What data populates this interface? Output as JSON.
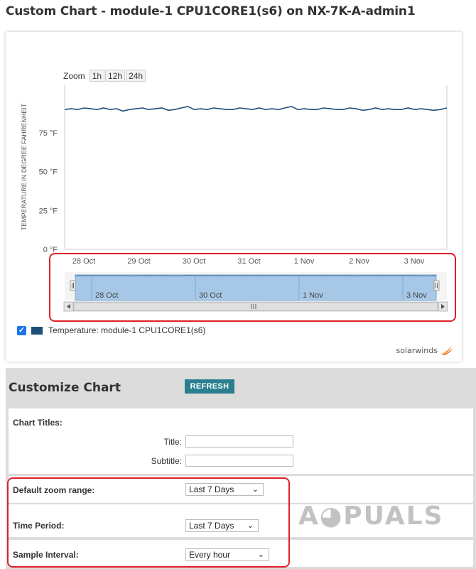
{
  "page": {
    "title": "Custom Chart - module-1 CPU1CORE1(s6) on NX-7K-A-admin1"
  },
  "zoom": {
    "label": "Zoom",
    "buttons": [
      "1h",
      "12h",
      "24h"
    ]
  },
  "chart_data": {
    "type": "line",
    "title": "",
    "ylabel": "TEMPERATURE IN DEGREE FAHRENHEIT",
    "yticks": [
      "0 °F",
      "25 °F",
      "50 °F",
      "75 °F"
    ],
    "ytick_values": [
      0,
      25,
      50,
      75
    ],
    "ylim": [
      0,
      100
    ],
    "xticks": [
      "28 Oct",
      "29 Oct",
      "30 Oct",
      "31 Oct",
      "1 Nov",
      "2 Nov",
      "3 Nov"
    ],
    "grid": false,
    "series": [
      {
        "name": "Temperature: module-1 CPU1CORE1(s6)",
        "color": "#1f4e79",
        "values": [
          90,
          90.5,
          90,
          91,
          90.5,
          90,
          91,
          90,
          90.5,
          89,
          90,
          90.5,
          91,
          90,
          90.5,
          91,
          89.5,
          90,
          91,
          92,
          90,
          90.5,
          90,
          91,
          90.5,
          90,
          90,
          91,
          90.5,
          90,
          91,
          90,
          90.5,
          90,
          91,
          92,
          90,
          90.5,
          90,
          90,
          91,
          90.5,
          90,
          90,
          91,
          90.5,
          89.5,
          90,
          91,
          90,
          90.5,
          90,
          90,
          91,
          90,
          90.5,
          90,
          89.5,
          90,
          91
        ]
      }
    ],
    "navigator": {
      "xticks": [
        "28 Oct",
        "30 Oct",
        "1 Nov",
        "3 Nov"
      ]
    }
  },
  "legend": {
    "label": "Temperature: module-1 CPU1CORE1(s6)",
    "checked": "✓"
  },
  "brand": {
    "name": "solarwinds"
  },
  "customize": {
    "title": "Customize Chart",
    "refresh_label": "REFRESH",
    "chart_titles_label": "Chart Titles:",
    "title_label": "Title:",
    "subtitle_label": "Subtitle:",
    "default_zoom_label": "Default zoom range:",
    "default_zoom_value": "Last 7 Days",
    "time_period_label": "Time Period:",
    "time_period_value": "Last 7 Days",
    "sample_interval_label": "Sample Interval:",
    "sample_interval_value": "Every hour"
  },
  "colors": {
    "highlight": "#e01f26",
    "refresh": "#2a7f8f",
    "series": "#1f4e79",
    "navigator_fill": "#a6c8e6"
  }
}
